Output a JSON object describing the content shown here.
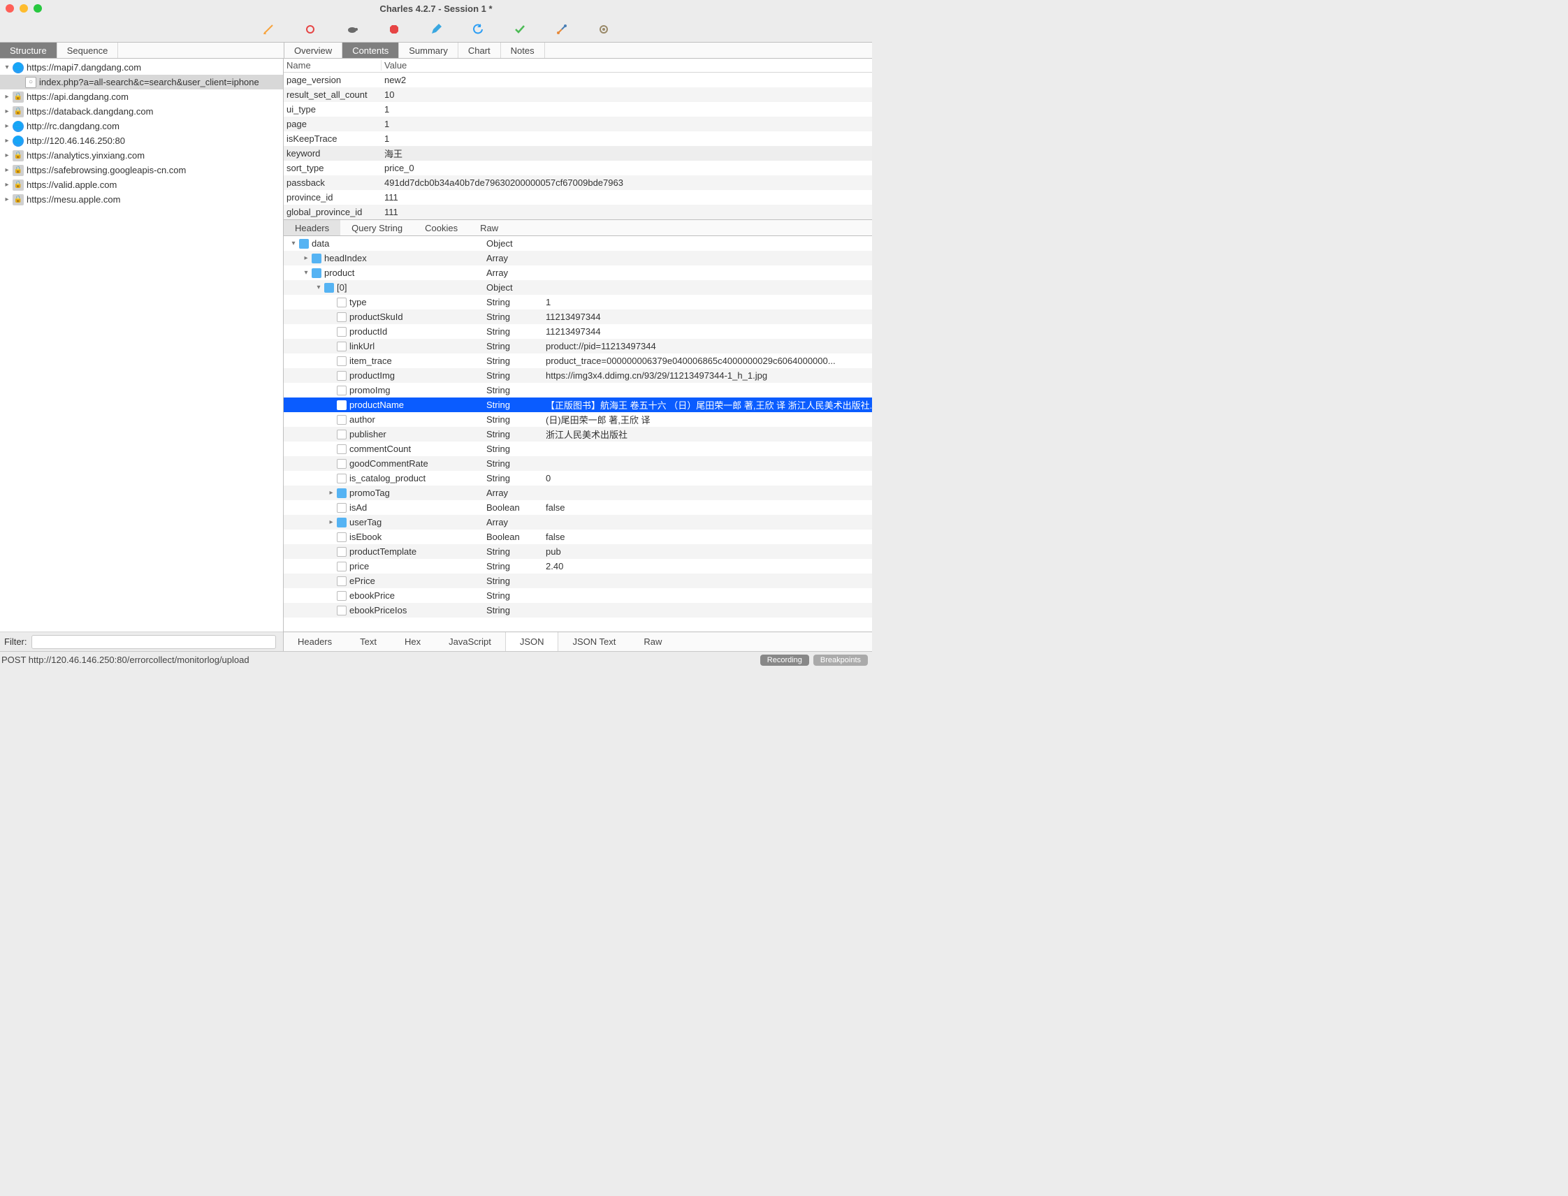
{
  "window": {
    "title": "Charles 4.2.7 - Session 1 *"
  },
  "toolbar_icons": [
    "broom-icon",
    "record-icon",
    "turtle-icon",
    "stop-icon",
    "pencil-icon",
    "refresh-icon",
    "check-icon",
    "wrench-icon",
    "gear-icon"
  ],
  "view_tabs": {
    "structure": "Structure",
    "sequence": "Sequence"
  },
  "detail_tabs": {
    "overview": "Overview",
    "contents": "Contents",
    "summary": "Summary",
    "chart": "Chart",
    "notes": "Notes"
  },
  "tree": {
    "items": [
      {
        "disclosure": "▾",
        "icon": "globe",
        "label": "https://mapi7.dangdang.com"
      },
      {
        "disclosure": "",
        "icon": "doc",
        "label": "index.php?a=all-search&c=search&user_client=iphone",
        "indent": 1,
        "selected": true
      },
      {
        "disclosure": "▸",
        "icon": "lock",
        "label": "https://api.dangdang.com"
      },
      {
        "disclosure": "▸",
        "icon": "lock",
        "label": "https://databack.dangdang.com"
      },
      {
        "disclosure": "▸",
        "icon": "globe",
        "label": "http://rc.dangdang.com"
      },
      {
        "disclosure": "▸",
        "icon": "globe",
        "label": "http://120.46.146.250:80"
      },
      {
        "disclosure": "▸",
        "icon": "lock",
        "label": "https://analytics.yinxiang.com"
      },
      {
        "disclosure": "▸",
        "icon": "lock",
        "label": "https://safebrowsing.googleapis-cn.com"
      },
      {
        "disclosure": "▸",
        "icon": "lock",
        "label": "https://valid.apple.com"
      },
      {
        "disclosure": "▸",
        "icon": "lock",
        "label": "https://mesu.apple.com"
      }
    ]
  },
  "kv": {
    "header_name": "Name",
    "header_value": "Value",
    "rows": [
      {
        "name": "page_version",
        "value": "new2"
      },
      {
        "name": "result_set_all_count",
        "value": "10"
      },
      {
        "name": "ui_type",
        "value": "1"
      },
      {
        "name": "page",
        "value": "1"
      },
      {
        "name": "isKeepTrace",
        "value": "1"
      },
      {
        "name": "keyword",
        "value": "海王",
        "highlighted": true
      },
      {
        "name": "sort_type",
        "value": "price_0"
      },
      {
        "name": "passback",
        "value": "491dd7dcb0b34a40b7de79630200000057cf67009bde7963"
      },
      {
        "name": "province_id",
        "value": "111"
      },
      {
        "name": "global_province_id",
        "value": "111"
      }
    ]
  },
  "sub_tabs": {
    "headers": "Headers",
    "query_string": "Query String",
    "cookies": "Cookies",
    "raw": "Raw"
  },
  "json_tree": [
    {
      "indent": 0,
      "disclosure": "▾",
      "icon": "folder",
      "name": "data",
      "type": "Object",
      "value": ""
    },
    {
      "indent": 1,
      "disclosure": "▸",
      "icon": "folder",
      "name": "headIndex",
      "type": "Array",
      "value": ""
    },
    {
      "indent": 1,
      "disclosure": "▾",
      "icon": "folder",
      "name": "product",
      "type": "Array",
      "value": ""
    },
    {
      "indent": 2,
      "disclosure": "▾",
      "icon": "folder",
      "name": "[0]",
      "type": "Object",
      "value": ""
    },
    {
      "indent": 3,
      "disclosure": "",
      "icon": "file",
      "name": "type",
      "type": "String",
      "value": "1"
    },
    {
      "indent": 3,
      "disclosure": "",
      "icon": "file",
      "name": "productSkuId",
      "type": "String",
      "value": "11213497344"
    },
    {
      "indent": 3,
      "disclosure": "",
      "icon": "file",
      "name": "productId",
      "type": "String",
      "value": "11213497344"
    },
    {
      "indent": 3,
      "disclosure": "",
      "icon": "file",
      "name": "linkUrl",
      "type": "String",
      "value": "product://pid=11213497344"
    },
    {
      "indent": 3,
      "disclosure": "",
      "icon": "file",
      "name": "item_trace",
      "type": "String",
      "value": "product_trace=000000006379e040006865c4000000029c6064000000..."
    },
    {
      "indent": 3,
      "disclosure": "",
      "icon": "file",
      "name": "productImg",
      "type": "String",
      "value": "https://img3x4.ddimg.cn/93/29/11213497344-1_h_1.jpg"
    },
    {
      "indent": 3,
      "disclosure": "",
      "icon": "file",
      "name": "promoImg",
      "type": "String",
      "value": ""
    },
    {
      "indent": 3,
      "disclosure": "",
      "icon": "file",
      "name": "productName",
      "type": "String",
      "value": "【正版图书】航海王 卷五十六 （日）尾田荣一郎 著,王欣 译 浙江人民美术出版社.",
      "selected": true
    },
    {
      "indent": 3,
      "disclosure": "",
      "icon": "file",
      "name": "author",
      "type": "String",
      "value": "(日)尾田荣一郎 著,王欣 译"
    },
    {
      "indent": 3,
      "disclosure": "",
      "icon": "file",
      "name": "publisher",
      "type": "String",
      "value": "浙江人民美术出版社"
    },
    {
      "indent": 3,
      "disclosure": "",
      "icon": "file",
      "name": "commentCount",
      "type": "String",
      "value": ""
    },
    {
      "indent": 3,
      "disclosure": "",
      "icon": "file",
      "name": "goodCommentRate",
      "type": "String",
      "value": ""
    },
    {
      "indent": 3,
      "disclosure": "",
      "icon": "file",
      "name": "is_catalog_product",
      "type": "String",
      "value": "0"
    },
    {
      "indent": 3,
      "disclosure": "▸",
      "icon": "folder",
      "name": "promoTag",
      "type": "Array",
      "value": ""
    },
    {
      "indent": 3,
      "disclosure": "",
      "icon": "file",
      "name": "isAd",
      "type": "Boolean",
      "value": "false"
    },
    {
      "indent": 3,
      "disclosure": "▸",
      "icon": "folder",
      "name": "userTag",
      "type": "Array",
      "value": ""
    },
    {
      "indent": 3,
      "disclosure": "",
      "icon": "file",
      "name": "isEbook",
      "type": "Boolean",
      "value": "false"
    },
    {
      "indent": 3,
      "disclosure": "",
      "icon": "file",
      "name": "productTemplate",
      "type": "String",
      "value": "pub"
    },
    {
      "indent": 3,
      "disclosure": "",
      "icon": "file",
      "name": "price",
      "type": "String",
      "value": "2.40"
    },
    {
      "indent": 3,
      "disclosure": "",
      "icon": "file",
      "name": "ePrice",
      "type": "String",
      "value": ""
    },
    {
      "indent": 3,
      "disclosure": "",
      "icon": "file",
      "name": "ebookPrice",
      "type": "String",
      "value": ""
    },
    {
      "indent": 3,
      "disclosure": "",
      "icon": "file",
      "name": "ebookPriceIos",
      "type": "String",
      "value": ""
    }
  ],
  "bottom_tabs": {
    "headers": "Headers",
    "text": "Text",
    "hex": "Hex",
    "javascript": "JavaScript",
    "json": "JSON",
    "json_text": "JSON Text",
    "raw": "Raw"
  },
  "filter": {
    "label": "Filter:",
    "value": ""
  },
  "status": {
    "text": "POST http://120.46.146.250:80/errorcollect/monitorlog/upload",
    "recording": "Recording",
    "breakpoints": "Breakpoints"
  },
  "icons": {
    "broom": "#f7a33c",
    "record": "#e64545",
    "turtle": "#6a6a6a",
    "stop": "#e64545",
    "pencil": "#3aa7e0",
    "refresh": "#2a9df4",
    "check": "#4cbb55",
    "wrench": "#6a6a6a",
    "gear": "#9a8a6a"
  }
}
